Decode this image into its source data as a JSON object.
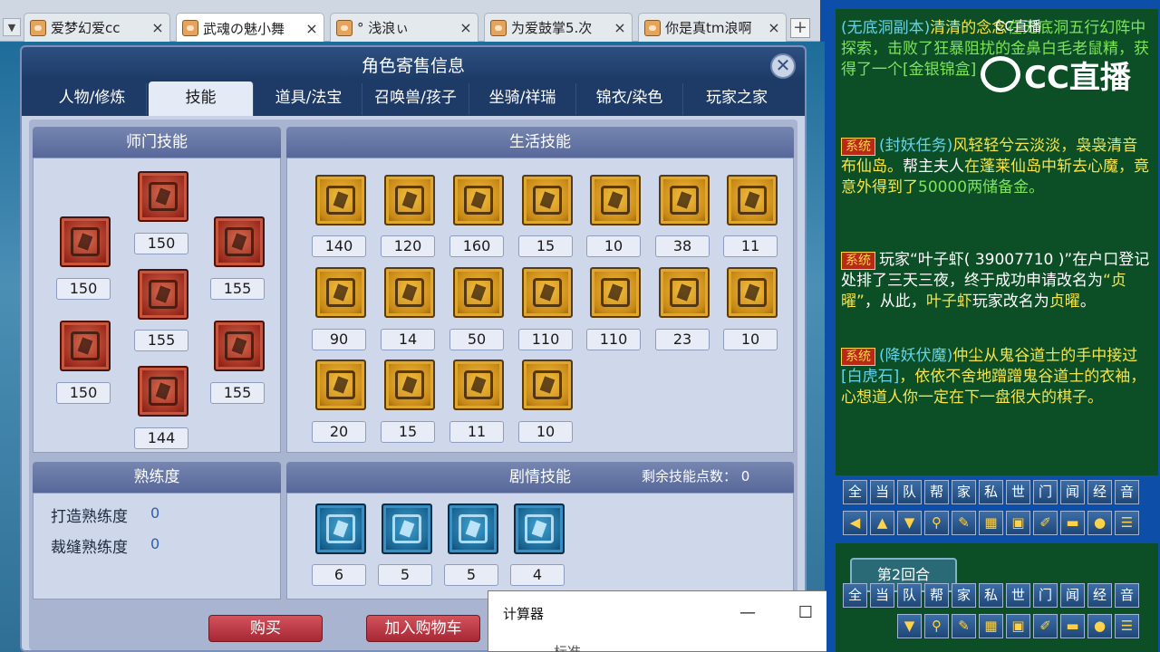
{
  "browser": {
    "tabs": [
      {
        "label": "爱梦幻爱cc",
        "close": "×"
      },
      {
        "label": "武魂の魅小舞",
        "close": "×"
      },
      {
        "label": "° 浅浪ぃ",
        "close": "×"
      },
      {
        "label": "为爱鼓掌5.次",
        "close": "×"
      },
      {
        "label": "你是真tm浪啊",
        "close": "×"
      }
    ],
    "new_tab": "+",
    "arrow": "▼"
  },
  "panel": {
    "title": "角色寄售信息",
    "close": "✕",
    "tabs": [
      "人物/修炼",
      "技能",
      "道具/法宝",
      "召唤兽/孩子",
      "坐骑/祥瑞",
      "锦衣/染色",
      "玩家之家"
    ],
    "active_tab": "技能"
  },
  "school_skills": {
    "title": "师门技能",
    "levels": [
      "150",
      "150",
      "155",
      "155",
      "150",
      "155",
      "144"
    ]
  },
  "life_skills": {
    "title": "生活技能",
    "levels": [
      "140",
      "120",
      "160",
      "15",
      "10",
      "38",
      "11",
      "90",
      "14",
      "50",
      "110",
      "110",
      "23",
      "10",
      "20",
      "15",
      "11",
      "10"
    ]
  },
  "proficiency": {
    "title": "熟练度",
    "rows": [
      {
        "label": "打造熟练度",
        "value": "0"
      },
      {
        "label": "裁缝熟练度",
        "value": "0"
      }
    ]
  },
  "story_skills": {
    "title": "剧情技能",
    "remaining": "剩余技能点数：  0",
    "levels": [
      "6",
      "5",
      "5",
      "4"
    ]
  },
  "buttons": {
    "buy": "购买",
    "add_cart": "加入购物车"
  },
  "calculator": {
    "title": "计算器",
    "minimize": "—",
    "maximize": "☐",
    "close": "✕",
    "mode": "标准"
  },
  "chat": {
    "watermark_small": "CC直播",
    "watermark_big": "CC直播",
    "messages": [
      {
        "text_a": "(无底洞副本)",
        "text_b": "清清的念念",
        "text_c": "在无底洞五行幻阵中探索，击败了狂暴阻扰的金鼻白毛老鼠精，获得了一个[金银锦盒]"
      },
      {
        "tag": "系统",
        "text_a": "(封妖任务)",
        "text_b": "风轻轻兮云淡淡，袅袅清音布仙岛。",
        "text_c": "帮主夫人",
        "text_d": "在蓬莱仙岛中斩去心魔，竟意外得到了",
        "text_e": "50000两储备金。"
      },
      {
        "tag": "系统",
        "text_a": "玩家“叶子虾( 39007710 )”在户口登记处排了三天三夜，终于成功申请改名为",
        "text_b": "“贞曜”",
        "text_c": "，从此，",
        "text_d": "叶子虾",
        "text_e": "玩家改名为",
        "text_f": "贞曜",
        "text_g": "。"
      },
      {
        "tag": "系统",
        "text_a": "(降妖伏魔)",
        "text_b": "仲尘",
        "text_c": "从鬼谷道士的手中接过",
        "text_d": "[白虎石]",
        "text_e": "，依依不舍地蹭蹭鬼谷道士的衣袖，心想道人你一定在下一盘很大的棋子。"
      }
    ],
    "channels": [
      "全",
      "当",
      "队",
      "帮",
      "家",
      "私",
      "世",
      "门",
      "闻",
      "经",
      "音"
    ],
    "round": "第2回合"
  }
}
